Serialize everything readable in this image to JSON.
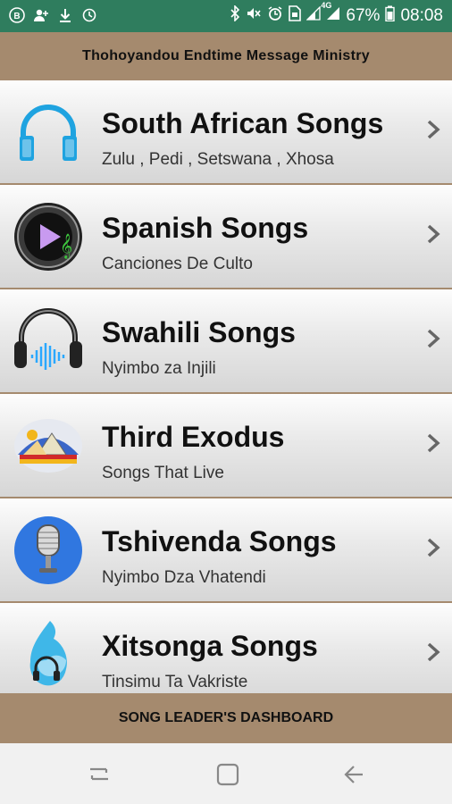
{
  "status_bar": {
    "left_icons": [
      "bbm-icon",
      "add-person-icon",
      "download-icon",
      "sync-icon"
    ],
    "right_icons": [
      "bluetooth-icon",
      "mute-icon",
      "alarm-icon",
      "sim-icon",
      "signal-icon",
      "signal-4g-icon",
      "battery-icon"
    ],
    "network_label": "4G",
    "battery": "67%",
    "time": "08:08"
  },
  "app_title": "Thohoyandou Endtime Message Ministry",
  "items": [
    {
      "title": "South African Songs",
      "subtitle": "Zulu , Pedi , Setswana , Xhosa",
      "icon": "headphones-icon"
    },
    {
      "title": "Spanish Songs",
      "subtitle": "Canciones De Culto",
      "icon": "play-music-icon"
    },
    {
      "title": "Swahili Songs",
      "subtitle": "Nyimbo za Injili",
      "icon": "headset-sound-icon"
    },
    {
      "title": "Third Exodus",
      "subtitle": "Songs That Live",
      "icon": "pyramid-logo-icon"
    },
    {
      "title": "Tshivenda Songs",
      "subtitle": "Nyimbo Dza Vhatendi",
      "icon": "microphone-icon"
    },
    {
      "title": "Xitsonga Songs",
      "subtitle": "Tinsimu Ta Vakriste",
      "icon": "flame-headphones-icon"
    }
  ],
  "footer_label": "SONG LEADER'S DASHBOARD",
  "colors": {
    "status_bar": "#2f7d5e",
    "brand_brown": "#a58a6e"
  }
}
